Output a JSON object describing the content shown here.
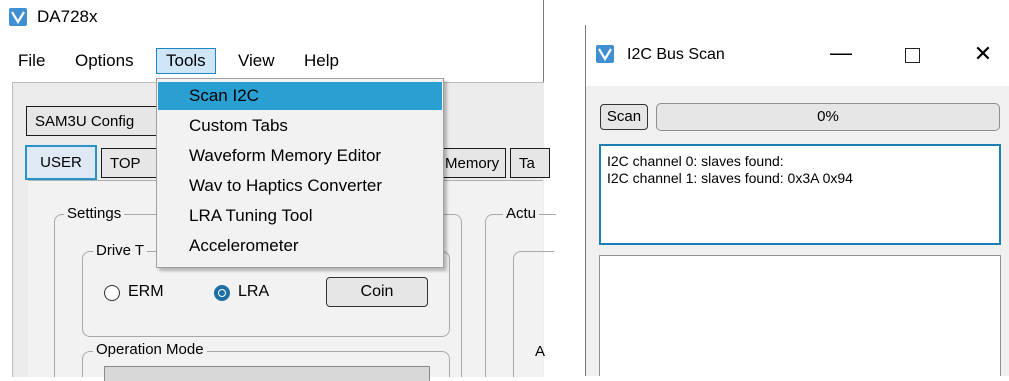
{
  "left_window": {
    "title": "DA728x",
    "menu": {
      "file": "File",
      "options": "Options",
      "tools": "Tools",
      "view": "View",
      "help": "Help"
    },
    "tools_menu_items": [
      "Scan I2C",
      "Custom Tabs",
      "Waveform Memory Editor",
      "Wav to Haptics Converter",
      "LRA Tuning Tool",
      "Accelerometer"
    ],
    "tabs_row1": [
      "SAM3U Config"
    ],
    "tabs_row2": [
      "USER",
      "TOP",
      "Memory",
      "Ta"
    ],
    "active_tab": "USER",
    "settings": {
      "label": "Settings",
      "drive_group_label": "Drive T",
      "radio_erm": "ERM",
      "radio_lra": "LRA",
      "selected_drive": "LRA",
      "coin_button": "Coin",
      "operation_mode_label": "Operation Mode"
    },
    "actuator_label": "Actu",
    "partial_label_a": "A"
  },
  "right_window": {
    "title": "I2C Bus Scan",
    "scan_button": "Scan",
    "progress_text": "0%",
    "progress_value": 0,
    "output_lines": [
      "I2C channel 0: slaves found:",
      "I2C channel 1: slaves found: 0x3A 0x94"
    ],
    "window_controls": {
      "minimize": "—",
      "close": "✕"
    }
  },
  "colors": {
    "accent": "#2aa0d2",
    "focus_border": "#1c80b5",
    "highlight_menu": "#cfe6f7"
  }
}
